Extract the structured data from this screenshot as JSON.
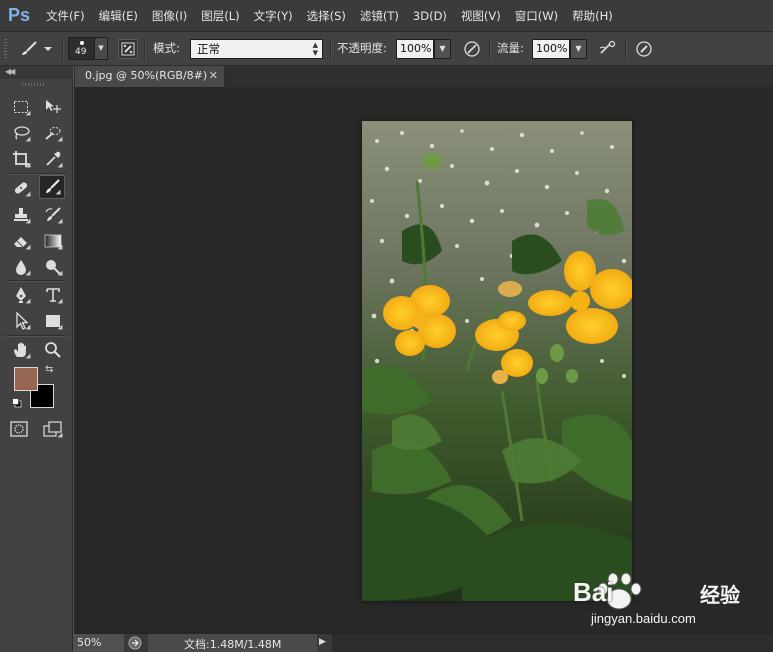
{
  "app": {
    "logo": "Ps"
  },
  "menu": [
    "文件(F)",
    "编辑(E)",
    "图像(I)",
    "图层(L)",
    "文字(Y)",
    "选择(S)",
    "滤镜(T)",
    "3D(D)",
    "视图(V)",
    "窗口(W)",
    "帮助(H)"
  ],
  "options": {
    "brush_size": "49",
    "mode_label": "模式:",
    "mode_value": "正常",
    "opacity_label": "不透明度:",
    "opacity_value": "100%",
    "flow_label": "流量:",
    "flow_value": "100%"
  },
  "document": {
    "tab_title": "0.jpg @ 50%(RGB/8#)"
  },
  "colors": {
    "foreground": "#976653",
    "background": "#000000"
  },
  "status": {
    "zoom": "50%",
    "doc_info": "文档:1.48M/1.48M"
  },
  "watermark": {
    "brand": "Bai",
    "brand_cn": "经验",
    "url": "jingyan.baidu.com"
  }
}
